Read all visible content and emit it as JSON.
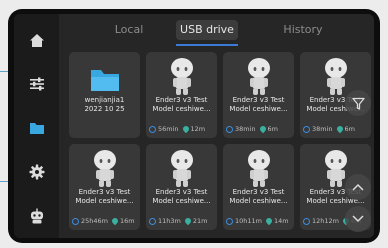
{
  "tabs": [
    {
      "label": "Local",
      "active": false
    },
    {
      "label": "USB drive",
      "active": true
    },
    {
      "label": "History",
      "active": false
    }
  ],
  "sidebar": {
    "items": [
      {
        "icon": "home-icon"
      },
      {
        "icon": "sliders-icon"
      },
      {
        "icon": "folder-icon",
        "active": true
      },
      {
        "icon": "gear-icon"
      },
      {
        "icon": "robot-icon"
      }
    ]
  },
  "files": [
    {
      "type": "folder",
      "name_line1": "wenjianjia1",
      "name_line2": "2022 10 25"
    },
    {
      "type": "model",
      "name_line1": "Ender3 v3 Test",
      "name_line2": "Model ceshiwe...",
      "time": "56min",
      "filament": "12m"
    },
    {
      "type": "model",
      "name_line1": "Ender3 v3 Test",
      "name_line2": "Model ceshiwe...",
      "time": "38min",
      "filament": "6m"
    },
    {
      "type": "model",
      "name_line1": "Ender3 v3 Test",
      "name_line2": "Model ceshiwe...",
      "time": "38min",
      "filament": "6m"
    },
    {
      "type": "model",
      "name_line1": "Ender3 v3 Test",
      "name_line2": "Model ceshiwe...",
      "time": "25h46m",
      "filament": "16m"
    },
    {
      "type": "model",
      "name_line1": "Ender3 v3 Test",
      "name_line2": "Model ceshiwe...",
      "time": "11h3m",
      "filament": "21m"
    },
    {
      "type": "model",
      "name_line1": "Ender3 v3 Test",
      "name_line2": "Model ceshiwe...",
      "time": "10h11m",
      "filament": "14m"
    },
    {
      "type": "model",
      "name_line1": "Ender3 v3 Test",
      "name_line2": "Model ceshiwe...",
      "time": "12h12m",
      "filament": "6m"
    }
  ],
  "colors": {
    "accent": "#3b7bd6",
    "folder": "#3aa8e0",
    "filament": "#39b0a0"
  }
}
